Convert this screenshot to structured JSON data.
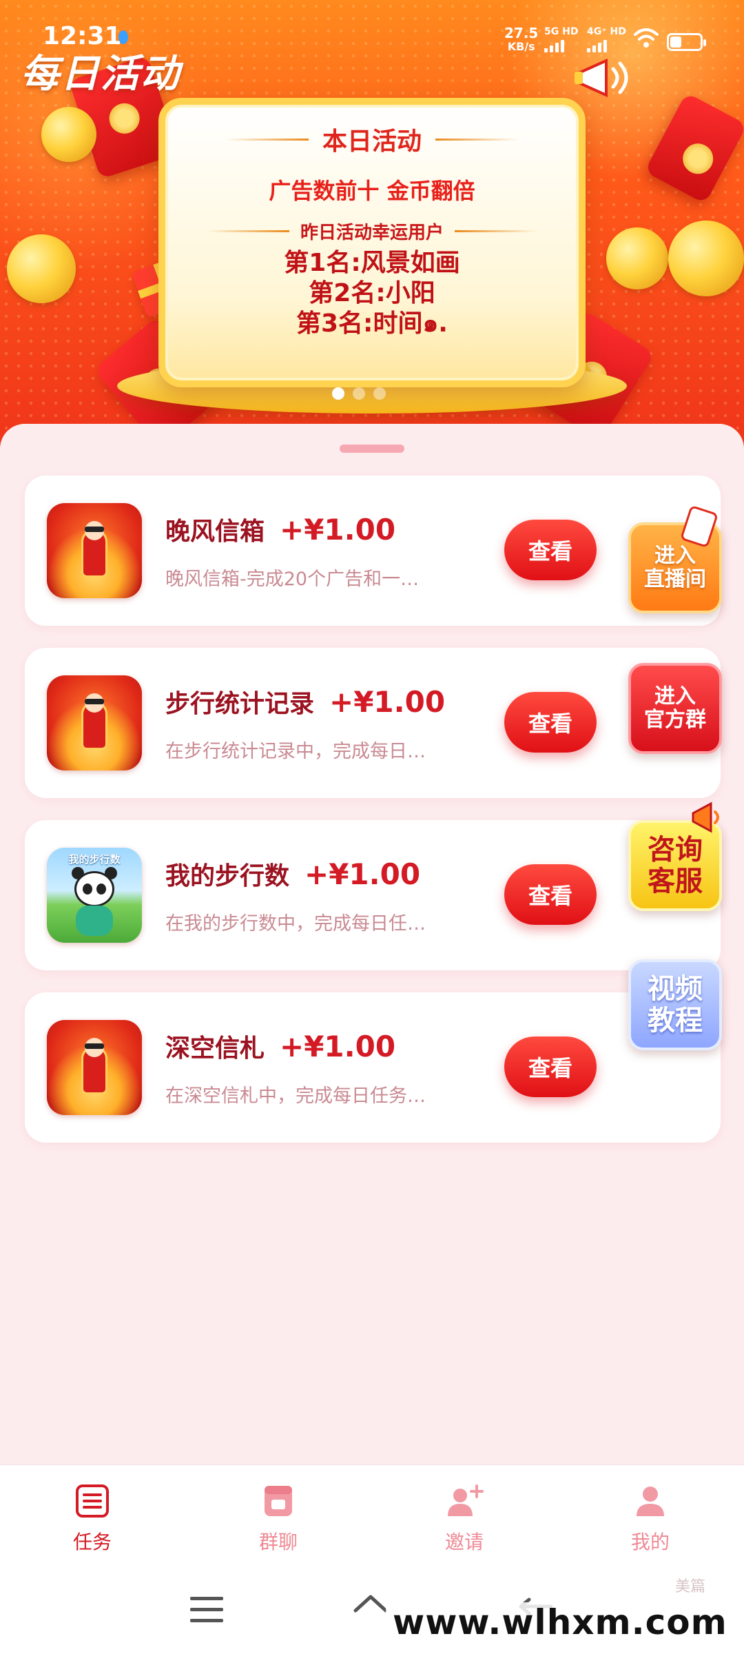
{
  "status_bar": {
    "time": "12:31",
    "speed_value": "27.5",
    "speed_unit": "KB/s",
    "sim1": "5G HD",
    "sim2": "4G⁺ HD"
  },
  "header": {
    "title": "每日活动"
  },
  "banner": {
    "heading": "本日活动",
    "promo": "广告数前十 金币翻倍",
    "subtitle": "昨日活动幸运用户",
    "winners": [
      "第1名:风景如画",
      "第2名:小阳",
      "第3名:时间๑."
    ],
    "slide_count": 3,
    "active_slide": 0
  },
  "tasks": [
    {
      "name": "晚风信箱",
      "reward": "+¥1.00",
      "desc": "晚风信箱-完成20个广告和一…",
      "button": "查看",
      "icon": "red-envelope-god-icon"
    },
    {
      "name": "步行统计记录",
      "reward": "+¥1.00",
      "desc": "在步行统计记录中，完成每日…",
      "button": "查看",
      "icon": "red-envelope-god-icon"
    },
    {
      "name": "我的步行数",
      "reward": "+¥1.00",
      "desc": "在我的步行数中，完成每日任…",
      "button": "查看",
      "icon": "panda-icon",
      "icon_label": "我的步行数"
    },
    {
      "name": "深空信札",
      "reward": "+¥1.00",
      "desc": "在深空信札中，完成每日任务…",
      "button": "查看",
      "icon": "red-envelope-god-icon"
    }
  ],
  "float_buttons": {
    "live": [
      "进入",
      "直播间"
    ],
    "group": [
      "进入",
      "官方群"
    ],
    "service": [
      "咨询",
      "客服"
    ],
    "video": [
      "视频",
      "教程"
    ]
  },
  "bottom_nav": [
    {
      "label": "任务",
      "icon": "task-list-icon",
      "active": true
    },
    {
      "label": "群聊",
      "icon": "group-chat-icon",
      "active": false
    },
    {
      "label": "邀请",
      "icon": "invite-user-icon",
      "active": false
    },
    {
      "label": "我的",
      "icon": "profile-icon",
      "active": false
    }
  ],
  "watermark": {
    "url": "www.wlhxm.com",
    "small": "美篇"
  },
  "colors": {
    "accent": "#d41b25",
    "banner": "#ff5a1a",
    "background": "#fdeced"
  }
}
